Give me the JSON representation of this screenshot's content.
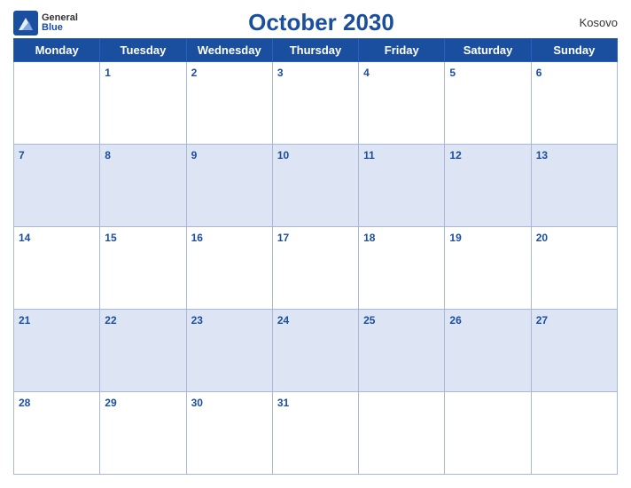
{
  "header": {
    "logo_general": "General",
    "logo_blue": "Blue",
    "title": "October 2030",
    "country": "Kosovo"
  },
  "days_of_week": [
    "Monday",
    "Tuesday",
    "Wednesday",
    "Thursday",
    "Friday",
    "Saturday",
    "Sunday"
  ],
  "weeks": [
    [
      null,
      1,
      2,
      3,
      4,
      5,
      6
    ],
    [
      7,
      8,
      9,
      10,
      11,
      12,
      13
    ],
    [
      14,
      15,
      16,
      17,
      18,
      19,
      20
    ],
    [
      21,
      22,
      23,
      24,
      25,
      26,
      27
    ],
    [
      28,
      29,
      30,
      31,
      null,
      null,
      null
    ]
  ]
}
